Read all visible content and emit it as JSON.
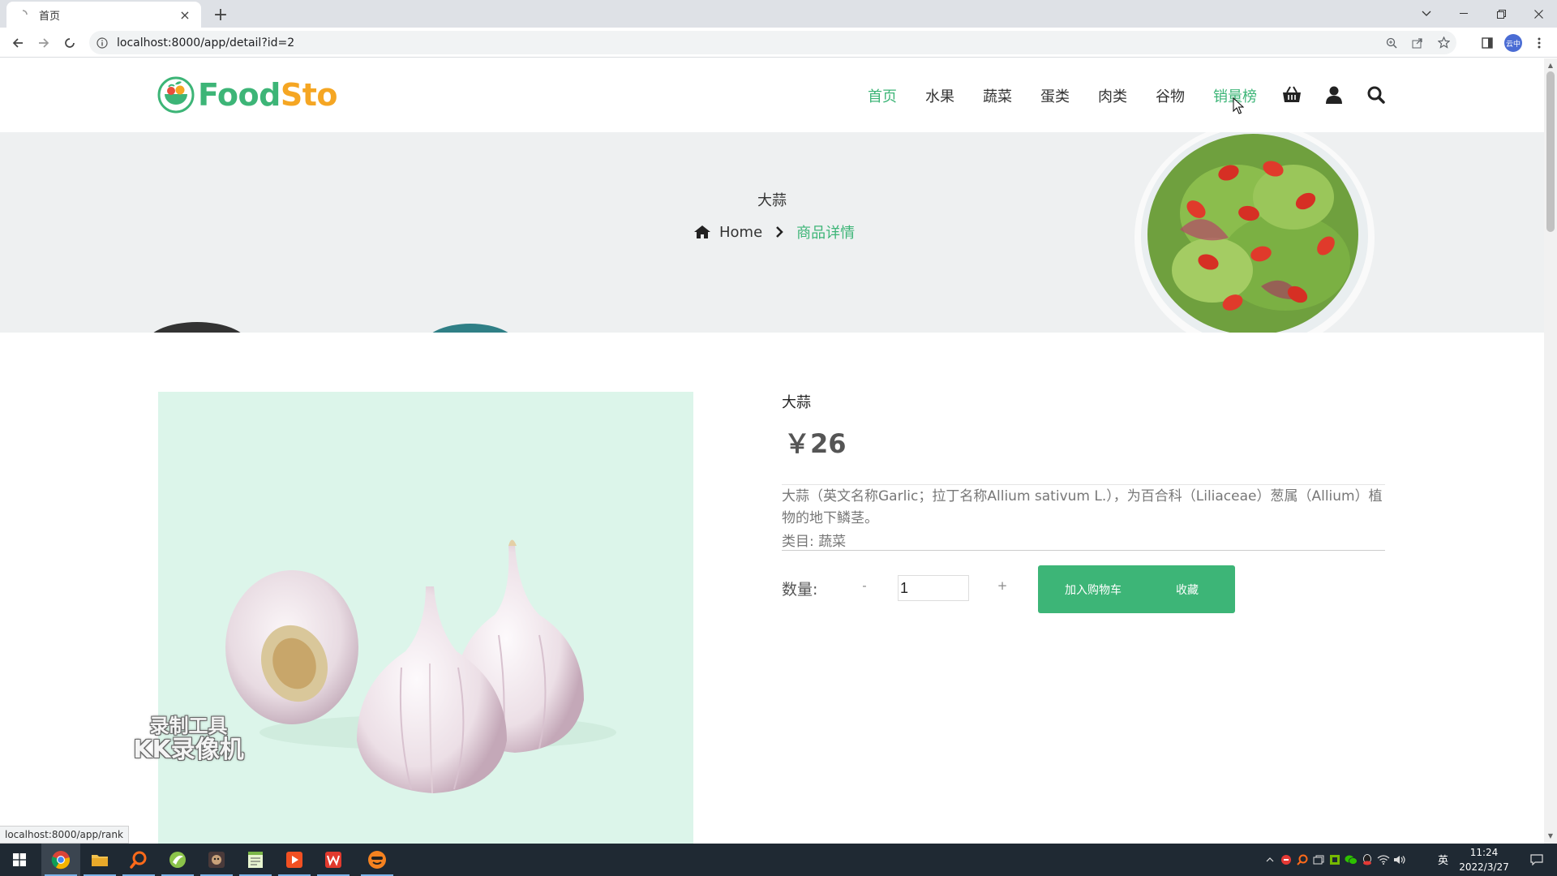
{
  "browser": {
    "tab_title": "首页",
    "tab_close": "×",
    "new_tab": "+",
    "url": "localhost:8000/app/detail?id=2",
    "status_url": "localhost:8000/app/rank",
    "profile_label": "云中"
  },
  "site": {
    "logo_food": "Food",
    "logo_sto": "Sto",
    "nav": [
      {
        "label": "首页",
        "state": "active"
      },
      {
        "label": "水果",
        "state": "normal"
      },
      {
        "label": "蔬菜",
        "state": "normal"
      },
      {
        "label": "蛋类",
        "state": "normal"
      },
      {
        "label": "肉类",
        "state": "normal"
      },
      {
        "label": "谷物",
        "state": "normal"
      },
      {
        "label": "销量榜",
        "state": "hover"
      }
    ],
    "accent_color": "#3db577",
    "logo_secondary_color": "#f5a623",
    "header_icons": [
      "basket-icon",
      "user-icon",
      "search-icon"
    ]
  },
  "banner": {
    "title": "大蒜",
    "breadcrumb_home": "Home",
    "breadcrumb_current": "商品详情"
  },
  "product": {
    "name": "大蒜",
    "price": "￥26",
    "description": "大蒜（英文名称Garlic；拉丁名称Allium sativum L.），为百合科（Liliaceae）葱属（Allium）植物的地下鳞茎。",
    "category": "类目: 蔬菜",
    "qty_label": "数量:",
    "qty_minus": "-",
    "qty_value": "1",
    "qty_plus": "+",
    "add_to_cart": "加入购物车",
    "favorite": "收藏",
    "image_bg": "#dcf5ea"
  },
  "watermark": {
    "line1": "录制工具",
    "line2": "KK录像机"
  },
  "taskbar": {
    "time": "11:24",
    "date": "2022/3/27",
    "ime": "英",
    "apps": [
      "windows-start-icon",
      "chrome-icon",
      "file-explorer-icon",
      "search-tool-icon",
      "green-app-icon",
      "game-app-icon",
      "notepad-icon",
      "media-app-icon",
      "wps-icon",
      "recorder-icon"
    ]
  }
}
